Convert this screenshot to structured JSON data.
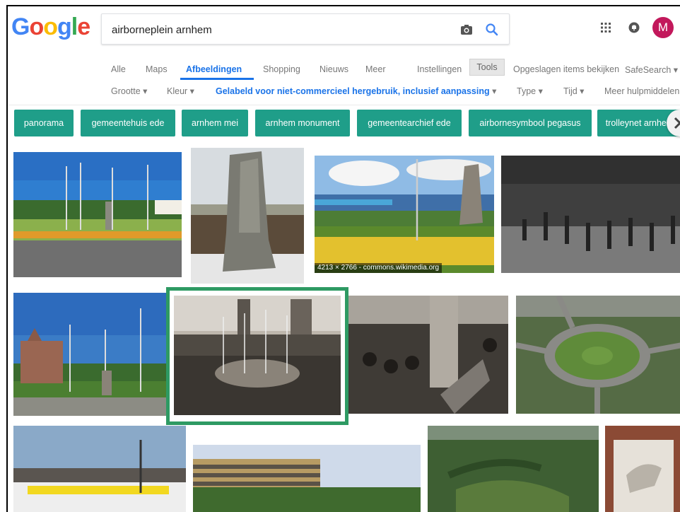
{
  "header": {
    "logo_letters": [
      "G",
      "o",
      "o",
      "g",
      "l",
      "e"
    ],
    "logo_colors": [
      "#4285F4",
      "#EA4335",
      "#FBBC05",
      "#4285F4",
      "#34A853",
      "#EA4335"
    ],
    "search_value": "airborneplein arnhem",
    "camera_icon": "camera-icon",
    "search_icon": "search-icon",
    "apps_icon": "apps-grid-icon",
    "notifications_icon": "notifications-icon",
    "avatar_letter": "M",
    "avatar_color": "#c2185b"
  },
  "tabs": [
    {
      "label": "Alle",
      "active": false
    },
    {
      "label": "Maps",
      "active": false
    },
    {
      "label": "Afbeeldingen",
      "active": true
    },
    {
      "label": "Shopping",
      "active": false
    },
    {
      "label": "Nieuws",
      "active": false
    },
    {
      "label": "Meer",
      "active": false
    },
    {
      "label": "Instellingen",
      "active": false
    },
    {
      "label": "Tools",
      "active": false
    },
    {
      "label": "Opgeslagen items bekijken",
      "active": false
    },
    {
      "label": "SafeSearch ▾",
      "active": false
    }
  ],
  "filters": [
    {
      "label": "Grootte ▾",
      "selected": false
    },
    {
      "label": "Kleur ▾",
      "selected": false
    },
    {
      "label": "Gelabeld voor niet-commercieel hergebruik, inclusief aanpassing",
      "selected": true,
      "suffix": " ▾"
    },
    {
      "label": "Type ▾",
      "selected": false
    },
    {
      "label": "Tijd ▾",
      "selected": false
    },
    {
      "label": "Meer hulpmiddelen ▾",
      "selected": false
    }
  ],
  "chips": [
    "panorama",
    "gemeentehuis ede",
    "arnhem mei",
    "arnhem monument",
    "gemeentearchief ede",
    "airbornesymbool pegasus",
    "trolleynet arnhem"
  ],
  "chip_color": "#1f9e89",
  "results": [
    {
      "caption": ""
    },
    {
      "caption": ""
    },
    {
      "caption": "4213 × 2766 - commons.wikimedia.org"
    },
    {
      "caption": ""
    },
    {
      "caption": ""
    },
    {
      "caption": ""
    },
    {
      "caption": ""
    },
    {
      "caption": ""
    },
    {
      "caption": ""
    },
    {
      "caption": ""
    },
    {
      "caption": ""
    },
    {
      "caption": ""
    }
  ],
  "highlight_color": "#2e9a63"
}
